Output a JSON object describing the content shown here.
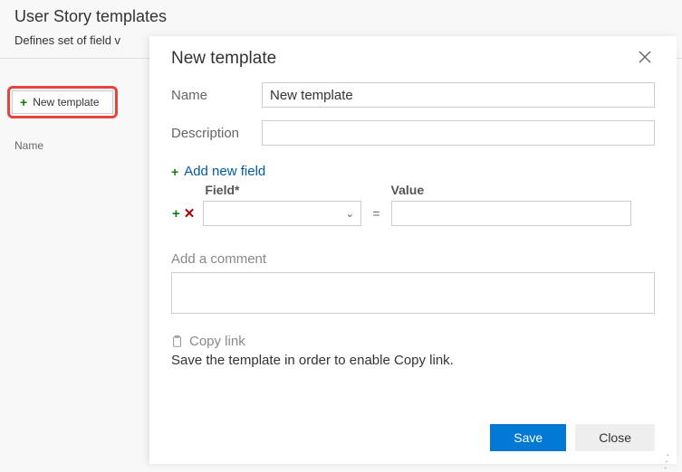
{
  "page": {
    "title": "User Story templates",
    "subtitle_visible": "Defines set of field v",
    "new_template_button": "New template",
    "column_name": "Name"
  },
  "dialog": {
    "title": "New template",
    "name_label": "Name",
    "name_value": "New template",
    "description_label": "Description",
    "description_value": "",
    "add_field_link": "Add new field",
    "field_header": "Field*",
    "value_header": "Value",
    "field_value": "",
    "value_value": "",
    "equals": "=",
    "comment_label": "Add a comment",
    "comment_value": "",
    "copy_link": "Copy link",
    "copy_link_hint": "Save the template in order to enable Copy link.",
    "save": "Save",
    "close": "Close"
  }
}
